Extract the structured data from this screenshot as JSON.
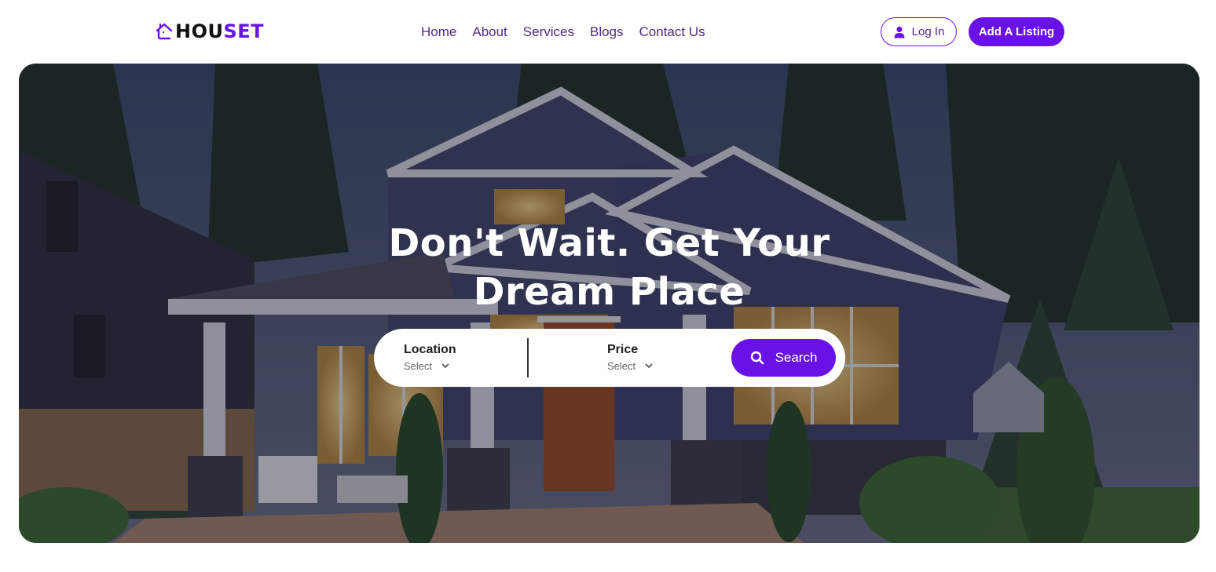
{
  "brand": {
    "name_part1": "HOU",
    "name_part2": "SET",
    "accent": "#6a11e6"
  },
  "nav": {
    "items": [
      "Home",
      "About",
      "Services",
      "Blogs",
      "Contact Us"
    ]
  },
  "header": {
    "login_label": "Log In",
    "listing_label": "Add A Listing",
    "login_icon": "user-icon"
  },
  "hero": {
    "title_line1": "Don't Wait. Get Your",
    "title_line2": "Dream Place"
  },
  "search": {
    "location_label": "Location",
    "location_value": "Select",
    "price_label": "Price",
    "price_value": "Select",
    "button_label": "Search",
    "button_icon": "search-icon"
  }
}
